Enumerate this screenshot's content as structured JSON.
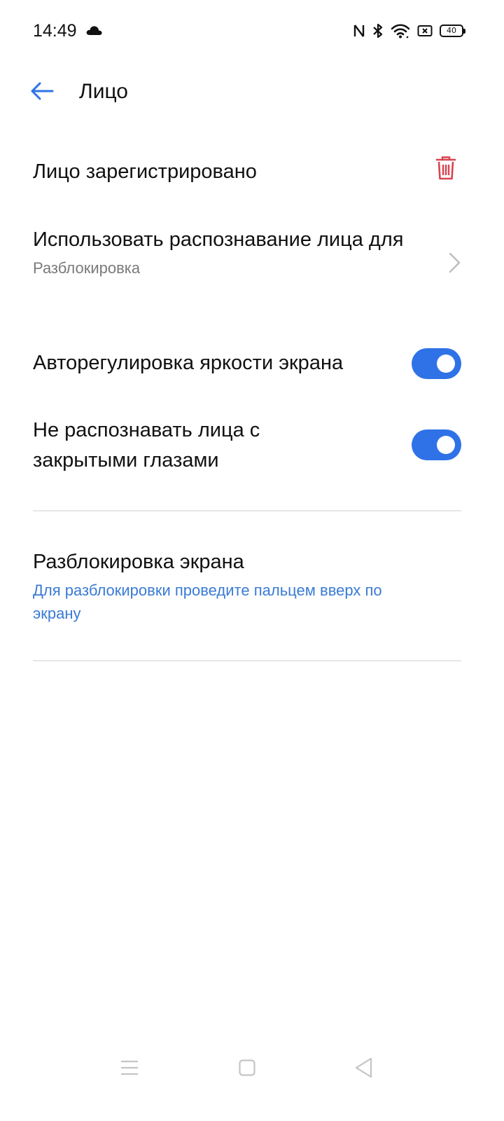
{
  "status_bar": {
    "time": "14:49",
    "battery_level": "40",
    "icons": [
      "cloud-icon",
      "nfc-icon",
      "bluetooth-icon",
      "wifi-icon",
      "sim-icon",
      "battery-icon"
    ]
  },
  "header": {
    "title": "Лицо",
    "back_icon": "arrow-left-icon"
  },
  "settings": {
    "face_registered": {
      "title": "Лицо зарегистрировано",
      "icon": "trash-icon"
    },
    "use_face_for": {
      "title": "Использовать распознавание лица для",
      "value": "Разблокировка"
    },
    "auto_brightness": {
      "title": "Авторегулировка яркости экрана",
      "enabled": true
    },
    "no_closed_eyes": {
      "title": "Не распознавать лица с закрытыми глазами",
      "enabled": true
    },
    "screen_unlock": {
      "title": "Разблокировка экрана",
      "description": "Для разблокировки проведите пальцем вверх по экрану"
    }
  },
  "nav_bar": {
    "buttons": [
      "menu-icon",
      "home-icon",
      "back-triangle-icon"
    ]
  },
  "colors": {
    "accent": "#2f72e8",
    "link": "#3a7bd5",
    "danger": "#d9434f",
    "subtext": "#7a7a7a",
    "divider": "#e6e6e6"
  }
}
